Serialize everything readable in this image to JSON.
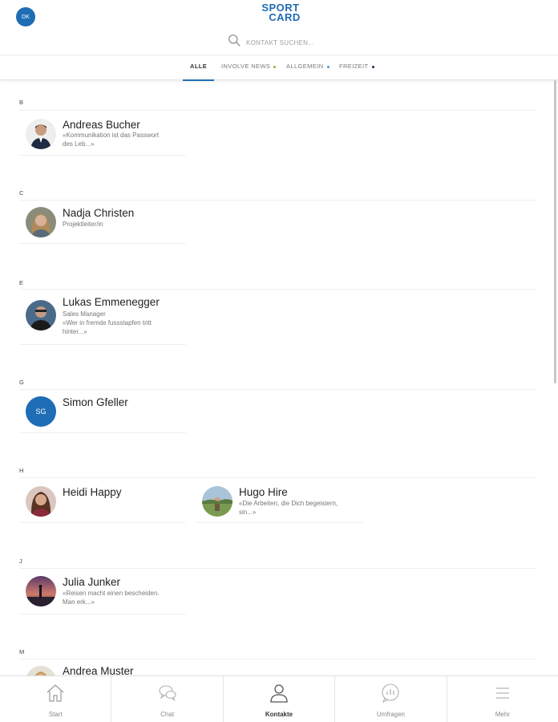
{
  "header": {
    "user_initials": "DK",
    "logo_line1": "SPORT",
    "logo_line2": "CARD",
    "search_placeholder": "KONTAKT SUCHEN..."
  },
  "tabs": [
    {
      "label": "ALLE",
      "active": true
    },
    {
      "label": "INVOLVE NEWS",
      "dot_color": "#8ab63f"
    },
    {
      "label": "ALLGEMEIN",
      "dot_color": "#3aa0d8"
    },
    {
      "label": "FREIZEIT",
      "dot_color": "#1a2b55"
    }
  ],
  "sections": [
    {
      "letter": "B",
      "contacts": [
        {
          "name": "Andreas Bucher",
          "lines": [
            "«Kommunikation ist das Passwort",
            "des Leb...»"
          ],
          "avatar": "man-icon"
        }
      ]
    },
    {
      "letter": "C",
      "contacts": [
        {
          "name": "Nadja Christen",
          "lines": [
            "Projektleiter/in"
          ],
          "avatar": "woman-icon"
        }
      ]
    },
    {
      "letter": "E",
      "contacts": [
        {
          "name": "Lukas Emmenegger",
          "lines": [
            "Sales Manager",
            "«Wer in fremde fussstapfen tritt",
            "hinter...»"
          ],
          "avatar": "man-icon"
        }
      ]
    },
    {
      "letter": "G",
      "contacts": [
        {
          "name": "Simon Gfeller",
          "lines": [],
          "initials": "SG"
        }
      ]
    },
    {
      "letter": "H",
      "contacts": [
        {
          "name": "Heidi Happy",
          "lines": [],
          "avatar": "woman-icon"
        },
        {
          "name": "Hugo Hire",
          "lines": [
            "«Die Arbeiten, die Dich begeistern,",
            "sin...»"
          ],
          "avatar": "landscape-icon"
        }
      ]
    },
    {
      "letter": "J",
      "contacts": [
        {
          "name": "Julia Junker",
          "lines": [
            "«Reisen macht einen bescheiden.",
            "Man erk...»"
          ],
          "avatar": "sunset-icon"
        }
      ]
    },
    {
      "letter": "M",
      "contacts": [
        {
          "name": "Andrea Muster",
          "lines": [],
          "avatar": "woman-icon"
        }
      ]
    }
  ],
  "bottom_nav": [
    {
      "label": "Start",
      "icon": "home-icon"
    },
    {
      "label": "Chat",
      "icon": "chat-icon"
    },
    {
      "label": "Kontakte",
      "icon": "person-icon",
      "active": true
    },
    {
      "label": "Umfragen",
      "icon": "poll-icon"
    },
    {
      "label": "Mehr",
      "icon": "menu-icon"
    }
  ],
  "colors": {
    "accent": "#1f6db4",
    "avatar_bg": "#1f6db4"
  }
}
